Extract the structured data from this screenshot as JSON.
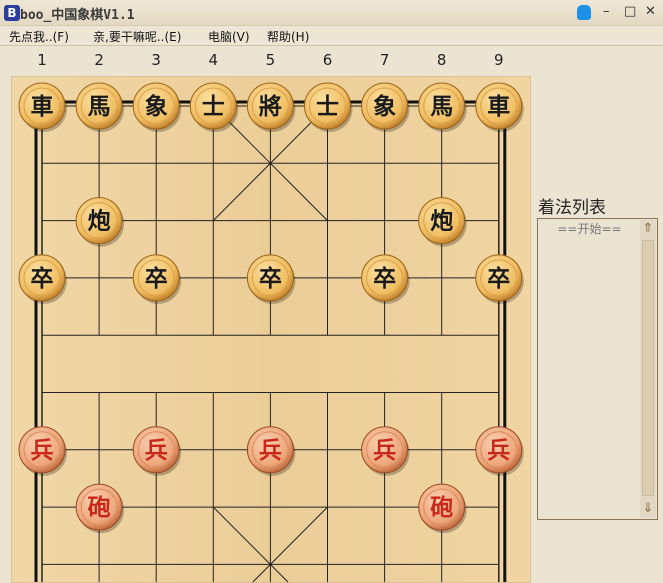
{
  "window": {
    "title": "boo_中国象棋V1.1",
    "minimize": "–",
    "maximize": "□",
    "close": "✕"
  },
  "menu": [
    {
      "label": "先点我..(F)"
    },
    {
      "label": "亲,要干嘛呢..(E)"
    },
    {
      "label": "电脑(V)"
    },
    {
      "label": "帮助(H)"
    }
  ],
  "columns": [
    "1",
    "2",
    "3",
    "4",
    "5",
    "6",
    "7",
    "8",
    "9"
  ],
  "colors": {
    "black_text": "#1a1a1a",
    "red_text": "#c8281a",
    "piece_light": "#f5cc7a",
    "piece_dark": "#c9842e",
    "red_piece_light": "#f3b58a",
    "red_piece_dark": "#c8673a"
  },
  "pieces": [
    {
      "char": "車",
      "side": "black",
      "col": 0,
      "row": 0
    },
    {
      "char": "馬",
      "side": "black",
      "col": 1,
      "row": 0
    },
    {
      "char": "象",
      "side": "black",
      "col": 2,
      "row": 0
    },
    {
      "char": "士",
      "side": "black",
      "col": 3,
      "row": 0
    },
    {
      "char": "將",
      "side": "black",
      "col": 4,
      "row": 0
    },
    {
      "char": "士",
      "side": "black",
      "col": 5,
      "row": 0
    },
    {
      "char": "象",
      "side": "black",
      "col": 6,
      "row": 0
    },
    {
      "char": "馬",
      "side": "black",
      "col": 7,
      "row": 0
    },
    {
      "char": "車",
      "side": "black",
      "col": 8,
      "row": 0
    },
    {
      "char": "炮",
      "side": "black",
      "col": 1,
      "row": 2
    },
    {
      "char": "炮",
      "side": "black",
      "col": 7,
      "row": 2
    },
    {
      "char": "卒",
      "side": "black",
      "col": 0,
      "row": 3
    },
    {
      "char": "卒",
      "side": "black",
      "col": 2,
      "row": 3
    },
    {
      "char": "卒",
      "side": "black",
      "col": 4,
      "row": 3
    },
    {
      "char": "卒",
      "side": "black",
      "col": 6,
      "row": 3
    },
    {
      "char": "卒",
      "side": "black",
      "col": 8,
      "row": 3
    },
    {
      "char": "兵",
      "side": "red",
      "col": 0,
      "row": 6
    },
    {
      "char": "兵",
      "side": "red",
      "col": 2,
      "row": 6
    },
    {
      "char": "兵",
      "side": "red",
      "col": 4,
      "row": 6
    },
    {
      "char": "兵",
      "side": "red",
      "col": 6,
      "row": 6
    },
    {
      "char": "兵",
      "side": "red",
      "col": 8,
      "row": 6
    },
    {
      "char": "砲",
      "side": "red",
      "col": 1,
      "row": 7
    },
    {
      "char": "砲",
      "side": "red",
      "col": 7,
      "row": 7
    }
  ],
  "movelist": {
    "title": "着法列表",
    "start": "==开始=="
  }
}
